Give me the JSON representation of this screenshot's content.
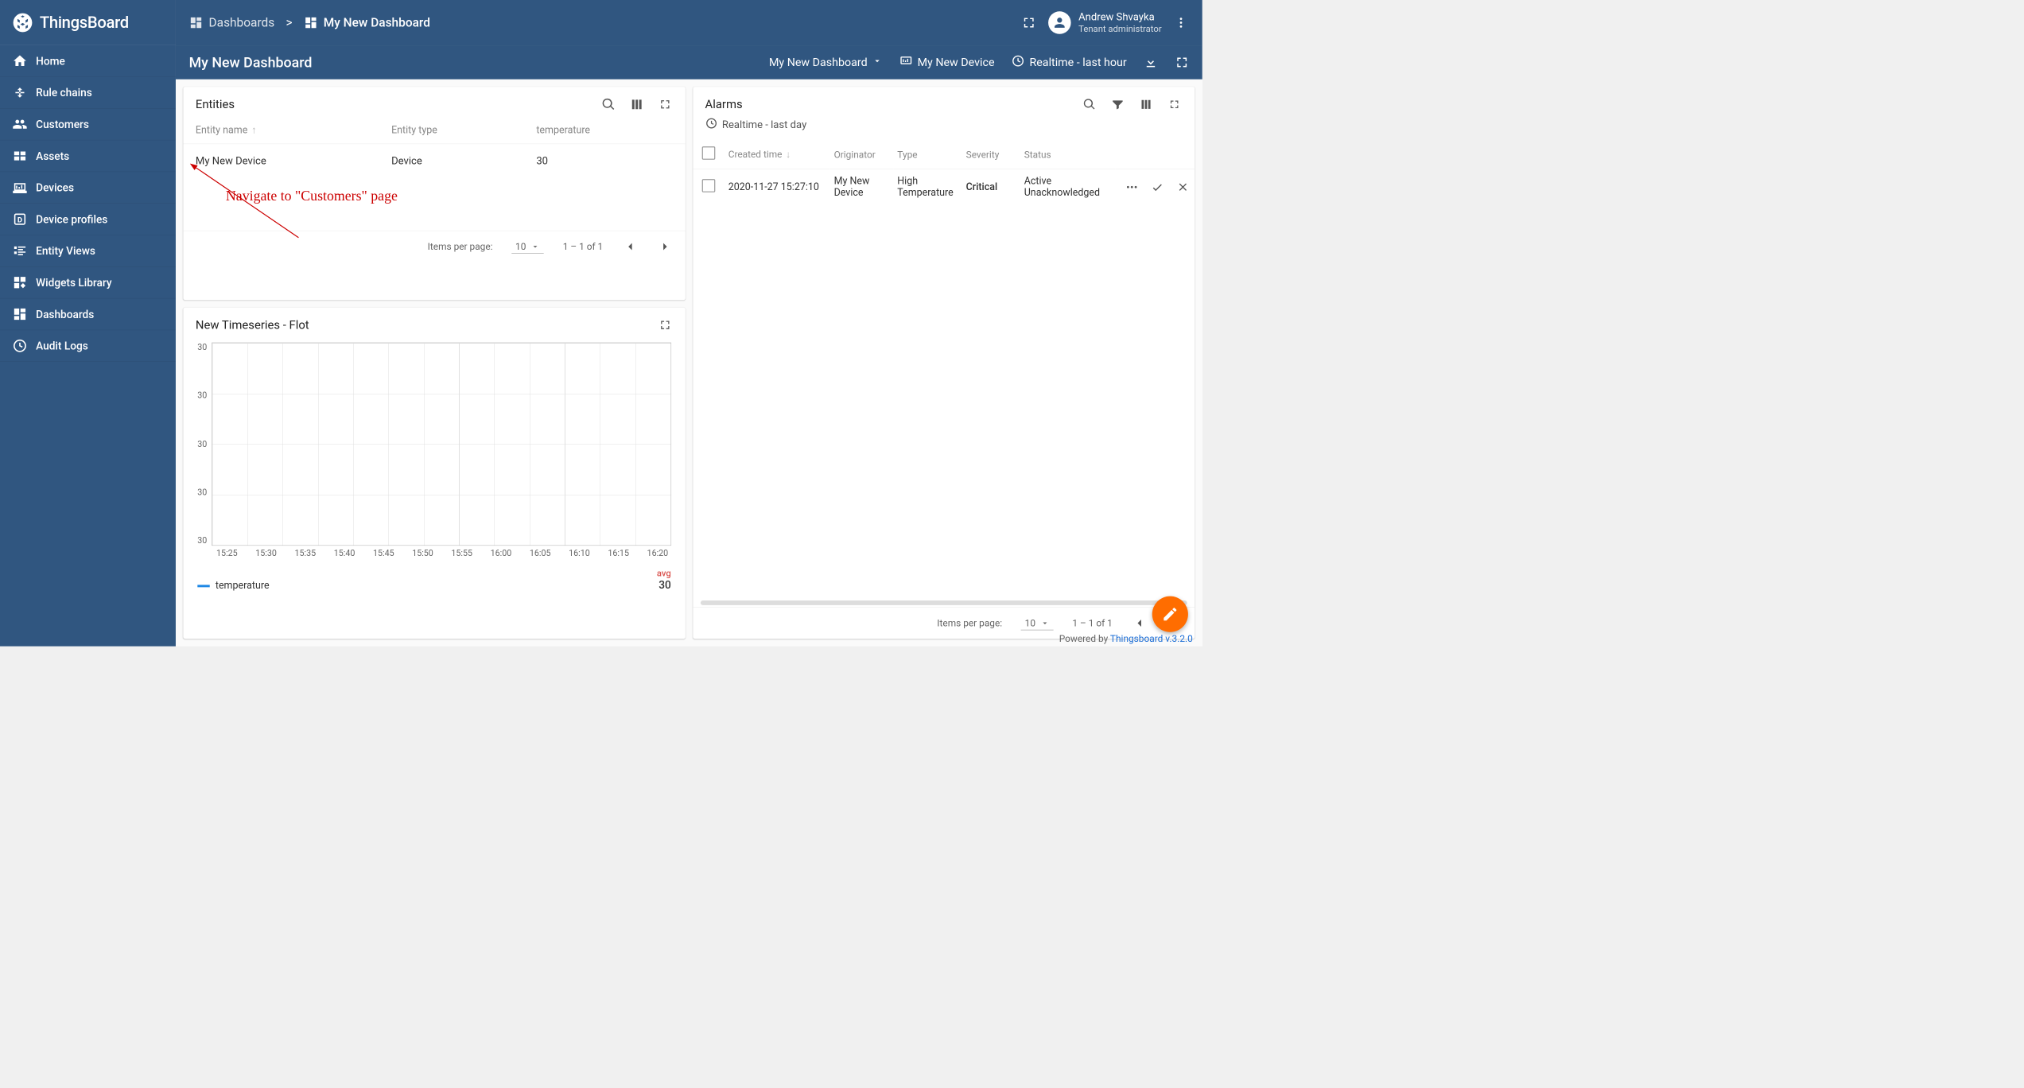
{
  "brand": "ThingsBoard",
  "sidebar": {
    "items": [
      {
        "label": "Home"
      },
      {
        "label": "Rule chains"
      },
      {
        "label": "Customers"
      },
      {
        "label": "Assets"
      },
      {
        "label": "Devices"
      },
      {
        "label": "Device profiles"
      },
      {
        "label": "Entity Views"
      },
      {
        "label": "Widgets Library"
      },
      {
        "label": "Dashboards"
      },
      {
        "label": "Audit Logs"
      }
    ]
  },
  "breadcrumb": {
    "root": "Dashboards",
    "sep": ">",
    "current": "My New Dashboard"
  },
  "user": {
    "name": "Andrew Shvayka",
    "role": "Tenant administrator"
  },
  "title": "My New Dashboard",
  "toolbar": {
    "dashboard_selector": "My New Dashboard",
    "device": "My New Device",
    "timewindow": "Realtime - last hour"
  },
  "entities": {
    "title": "Entities",
    "columns": [
      "Entity name",
      "Entity type",
      "temperature"
    ],
    "rows": [
      {
        "name": "My New Device",
        "type": "Device",
        "temperature": "30"
      }
    ],
    "pager": {
      "items_per_page_label": "Items per page:",
      "page_size": "10",
      "range": "1 – 1 of 1"
    }
  },
  "alarms": {
    "title": "Alarms",
    "timewindow": "Realtime - last day",
    "columns": [
      "Created time",
      "Originator",
      "Type",
      "Severity",
      "Status"
    ],
    "rows": [
      {
        "created": "2020-11-27 15:27:10",
        "originator": "My New Device",
        "type": "High Temperature",
        "severity": "Critical",
        "status": "Active Unacknowledged"
      }
    ],
    "pager": {
      "items_per_page_label": "Items per page:",
      "page_size": "10",
      "range": "1 – 1 of 1"
    }
  },
  "chart": {
    "title": "New Timeseries - Flot",
    "legend_label": "temperature",
    "avg_label": "avg",
    "avg_value": "30"
  },
  "chart_data": {
    "type": "line",
    "title": "New Timeseries - Flot",
    "x": [
      "15:25",
      "15:30",
      "15:35",
      "15:40",
      "15:45",
      "15:50",
      "15:55",
      "16:00",
      "16:05",
      "16:10",
      "16:15",
      "16:20"
    ],
    "y_ticks": [
      30,
      30,
      30,
      30,
      30
    ],
    "series": [
      {
        "name": "temperature",
        "values": [
          30,
          30,
          30,
          30,
          30,
          30,
          30,
          30,
          30,
          30,
          30,
          30
        ]
      }
    ],
    "xlabel": "",
    "ylabel": "",
    "ylim": [
      30,
      30
    ]
  },
  "annotation": "Navigate to \"Customers\" page",
  "footer": {
    "prefix": "Powered by ",
    "link": "Thingsboard v.3.2.0"
  }
}
